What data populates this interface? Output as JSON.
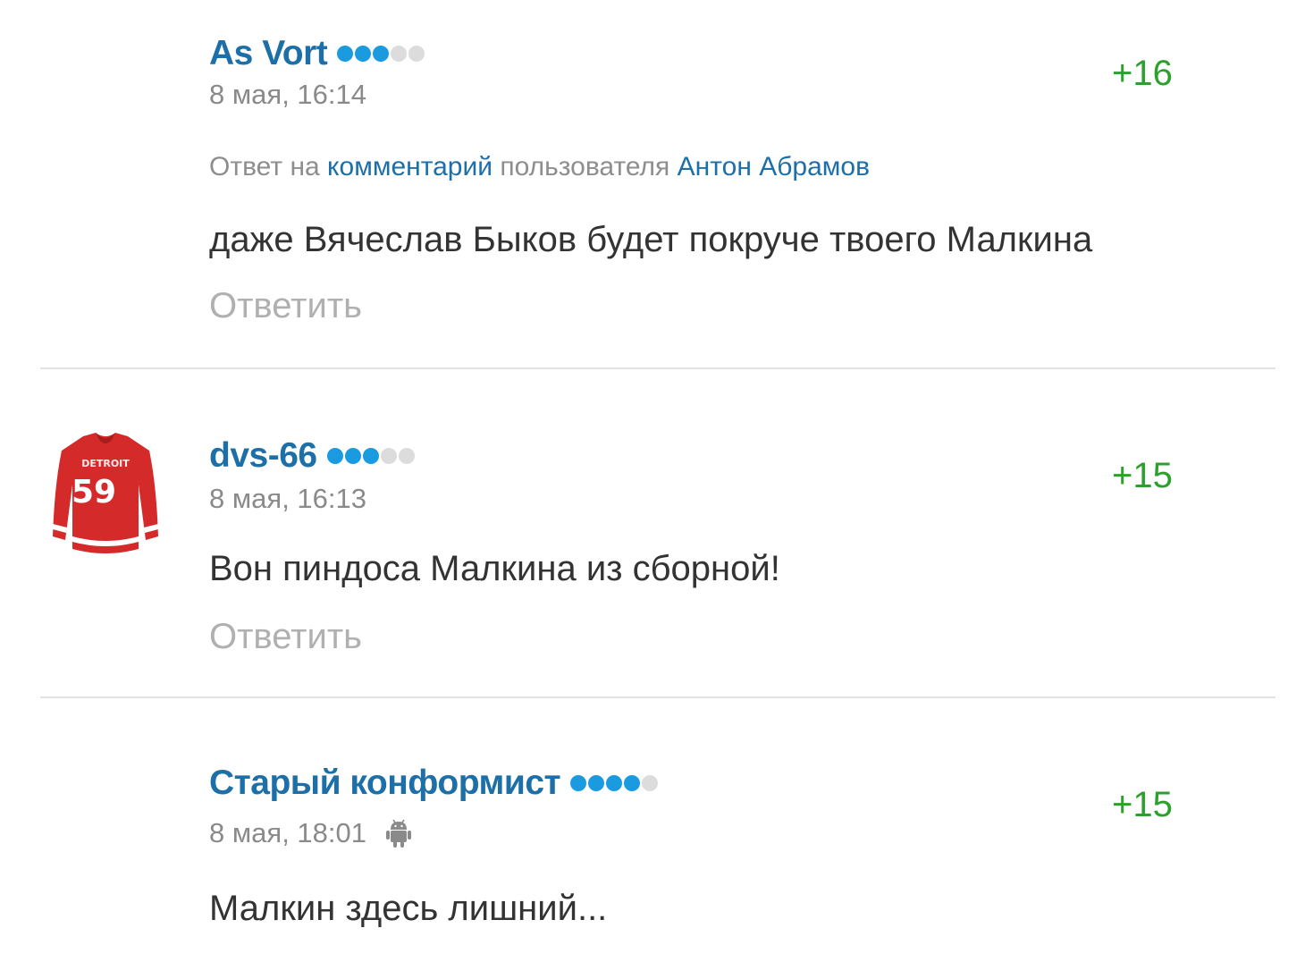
{
  "comments": [
    {
      "author": "As Vort",
      "rank_dots": [
        true,
        true,
        true,
        false,
        false
      ],
      "date": "8 мая, 16:14",
      "score": "+16",
      "reply_to": {
        "prefix": "Ответ на",
        "link": "комментарий",
        "middle": "пользователя",
        "user": "Антон Абрамов"
      },
      "text": "даже Вячеслав Быков будет покруче твоего Малкина",
      "reply_label": "Ответить"
    },
    {
      "author": "dvs-66",
      "avatar_icon": "hockey-jersey-59",
      "rank_dots": [
        true,
        true,
        true,
        false,
        false
      ],
      "date": "8 мая, 16:13",
      "score": "+15",
      "text": "Вон пиндоса Малкина из сборной!",
      "reply_label": "Ответить"
    },
    {
      "author": "Старый конформист",
      "rank_dots": [
        true,
        true,
        true,
        true,
        false
      ],
      "date": "8 мая, 18:01",
      "device_icon": "android-icon",
      "score": "+15",
      "text": "Малкин здесь лишний..."
    }
  ],
  "colors": {
    "author": "#1d6fa8",
    "score": "#2ca02c",
    "rank_on": "#1a9be0",
    "rank_off": "#dcdcdc",
    "meta": "#8a8a8a",
    "reply": "#b0b0b0"
  }
}
